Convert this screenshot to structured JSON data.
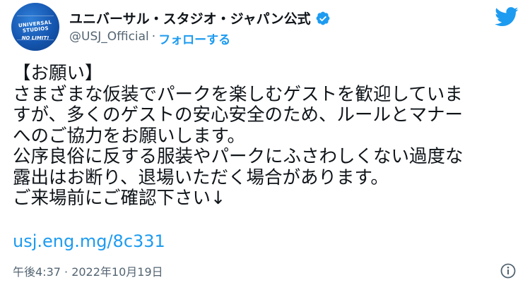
{
  "account": {
    "display_name": "ユニバーサル・スタジオ・ジャパン公式",
    "handle": "@USJ_Official",
    "separator": "·",
    "follow_label": "フォローする"
  },
  "avatar": {
    "logo_text": "UNIVERSAL STUDIOS",
    "logo_sub": "NO LIMIT!"
  },
  "tweet": {
    "lines": [
      "【お願い】",
      "さまざまな仮装でパークを楽しむゲストを歓迎していま",
      "すが、多くのゲストの安心安全のため、ルールとマナー",
      "へのご協力をお願いします。",
      "公序良俗に反する服装やパークにふさわしくない過度な",
      "露出はお断り、退場いただく場合があります。",
      "ご来場前にご確認下さい↓"
    ],
    "link": "usj.eng.mg/8c331"
  },
  "meta": {
    "timestamp": "午後4:37 · 2022年10月19日"
  },
  "colors": {
    "link": "#1d9bf0",
    "muted": "#536471",
    "text": "#0f1419"
  },
  "icons": {
    "verified": "verified-badge-icon",
    "brand": "twitter-bird-icon",
    "info": "info-icon"
  }
}
